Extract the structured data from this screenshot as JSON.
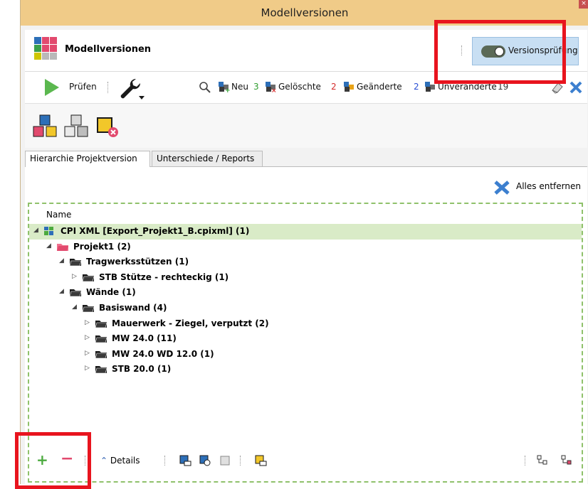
{
  "window": {
    "title": "Modellversionen",
    "close_glyph": "×"
  },
  "panel": {
    "title": "Modellversionen",
    "version_check_button": "Versionsprüfung"
  },
  "toolbar": {
    "check_label": "Prüfen",
    "filters": [
      {
        "label": "Neu",
        "count": "3",
        "count_color": "#2f9d2f"
      },
      {
        "label": "Gelöschte",
        "count": "2",
        "count_color": "#d42a2a"
      },
      {
        "label": "Geänderte",
        "count": "2",
        "count_color": "#2a4fd4"
      },
      {
        "label": "Unveränderte",
        "count": "19",
        "count_color": "#333333"
      }
    ]
  },
  "tabs": [
    {
      "label": "Hierarchie Projektversion",
      "active": true
    },
    {
      "label": "Unterschiede / Reports",
      "active": false
    }
  ],
  "content": {
    "remove_all_label": "Alles entfernen",
    "tree_column_header": "Name",
    "tree": [
      {
        "label": "CPI XML [Export_Projekt1_B.cpixml] (1)",
        "level": 0,
        "expanded": true,
        "icon": "cpi-model-icon",
        "selected": true
      },
      {
        "label": "Projekt1 (2)",
        "level": 1,
        "expanded": true,
        "icon": "project-folder-icon"
      },
      {
        "label": "Tragwerksstützen (1)",
        "level": 2,
        "expanded": true,
        "icon": "folder-icon"
      },
      {
        "label": "STB Stütze - rechteckig (1)",
        "level": 3,
        "expanded": false,
        "icon": "folder-icon"
      },
      {
        "label": "Wände (1)",
        "level": 2,
        "expanded": true,
        "icon": "folder-icon"
      },
      {
        "label": "Basiswand (4)",
        "level": 3,
        "expanded": true,
        "icon": "folder-icon"
      },
      {
        "label": "Mauerwerk - Ziegel, verputzt (2)",
        "level": 4,
        "expanded": false,
        "icon": "folder-icon"
      },
      {
        "label": "MW 24.0 (11)",
        "level": 4,
        "expanded": false,
        "icon": "folder-icon"
      },
      {
        "label": "MW 24.0 WD 12.0 (1)",
        "level": 4,
        "expanded": false,
        "icon": "folder-icon"
      },
      {
        "label": "STB 20.0 (1)",
        "level": 4,
        "expanded": false,
        "icon": "folder-icon"
      }
    ],
    "bottom_details_label": "Details"
  },
  "colors": {
    "titlebar": "#f0cb88",
    "highlight": "#e8141e",
    "selection": "#d9ebc7",
    "tree_border": "#8fc16b"
  }
}
